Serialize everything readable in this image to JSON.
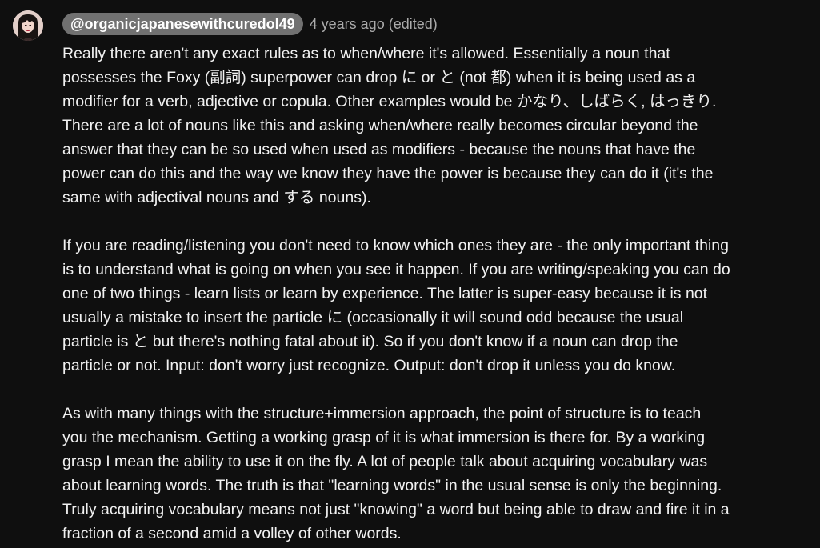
{
  "comment": {
    "author_handle": "@organicjapanesewithcuredol49",
    "timestamp": "4 years ago (edited)",
    "paragraphs": [
      [
        "Really there aren't any exact rules as to when/where it's allowed. Essentially a noun that",
        "possesses the Foxy (副詞) superpower can drop に or と (not 都) when it is being used as a",
        "modifier for  a verb, adjective or copula. Other examples would be かなり、しばらく, はっきり.",
        "There are a lot of nouns like this and asking when/where really becomes circular beyond the",
        "answer that they can be so used when used as modifiers - because the nouns that have the",
        "power can do this and the way we know they have the power is because they can do it (it's the",
        "same with adjectival nouns and する nouns)."
      ],
      [
        "If you are reading/listening you don't need to know which ones they are - the only important thing",
        "is to understand what is going on when you see it happen. If you are writing/speaking you can do",
        "one of two things - learn lists or learn by experience. The latter is super-easy because it is not",
        "usually a mistake to insert the particle に (occasionally it will sound odd because the usual",
        "particle is と but there's nothing fatal about it). So if you don't know if a noun can drop the",
        "particle or not. Input: don't worry just recognize. Output: don't drop it unless you do know."
      ],
      [
        "As with many things with the structure+immersion approach, the point of structure is to teach",
        "you the mechanism. Getting a working grasp of it is what immersion is there for. By a working",
        "grasp I mean the ability to use it on the fly. A lot of people talk about acquiring vocabulary was",
        "about learning words. The truth is that \"learning words\" in the usual sense is only the beginning.",
        "Truly acquiring vocabulary means not just \"knowing\" a word but being able to draw and fire it in a",
        "fraction of a second amid a volley of other words."
      ]
    ]
  }
}
